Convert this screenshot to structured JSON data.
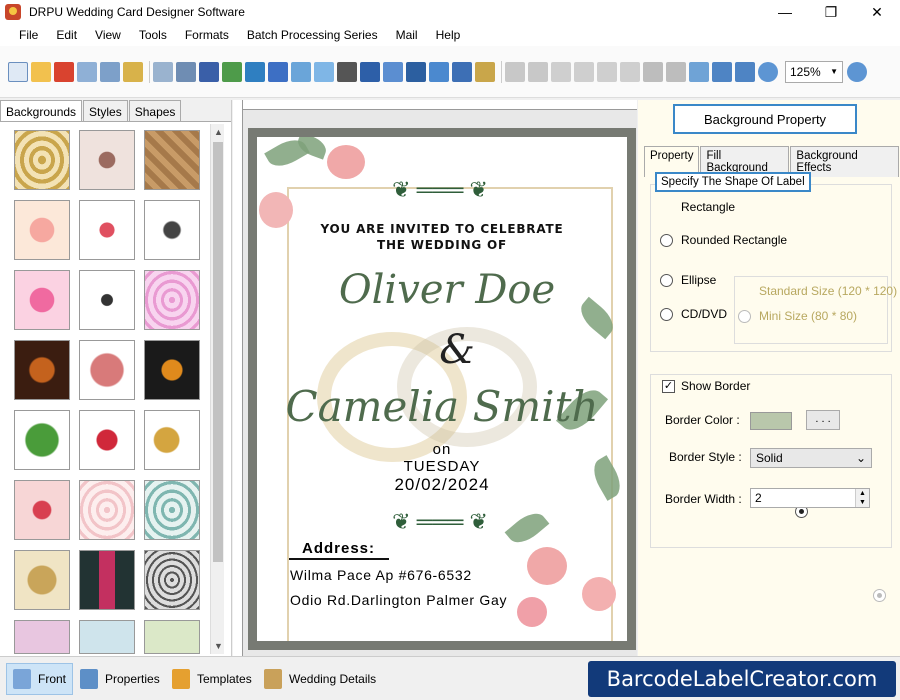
{
  "window": {
    "title": "DRPU Wedding Card Designer Software",
    "controls": [
      "—",
      "❐",
      "✕"
    ]
  },
  "menu": [
    "File",
    "Edit",
    "View",
    "Tools",
    "Formats",
    "Batch Processing Series",
    "Mail",
    "Help"
  ],
  "toolbar": {
    "zoom_value": "125%"
  },
  "left_panel": {
    "tabs": [
      "Backgrounds",
      "Styles",
      "Shapes"
    ],
    "active_tab": "Backgrounds"
  },
  "card": {
    "invite_line1": "YOU ARE INVITED TO CELEBRATE",
    "invite_line2": "THE WEDDING OF",
    "groom": "Oliver  Doe",
    "ampersand": "&",
    "bride": "Camelia  Smith",
    "on": "on",
    "day": "TUESDAY",
    "date": "20/02/2024",
    "address_label": "Address:",
    "address_line1": "Wilma Pace Ap #676-6532",
    "address_line2": "Odio Rd.Darlington Palmer Gay"
  },
  "right_panel": {
    "title": "Background Property",
    "tabs": [
      "Property",
      "Fill Background",
      "Background Effects"
    ],
    "shape_title": "Specify The Shape Of Label",
    "shapes": {
      "rectangle": "Rectangle",
      "rounded": "Rounded Rectangle",
      "ellipse": "Ellipse",
      "cd": "CD/DVD"
    },
    "sizes": {
      "standard": "Standard Size (120 * 120)",
      "mini": "Mini Size (80 * 80)"
    },
    "show_border": "Show Border",
    "border_color_label": "Border Color :",
    "border_color_btn": ". . .",
    "border_style_label": "Border Style :",
    "border_style_value": "Solid",
    "border_width_label": "Border Width :",
    "border_width_value": "2",
    "border_color": "#b9c7ab"
  },
  "bottom": {
    "front": "Front",
    "properties": "Properties",
    "templates": "Templates",
    "wedding_details": "Wedding Details",
    "watermark": "BarcodeLabelCreator.com"
  }
}
